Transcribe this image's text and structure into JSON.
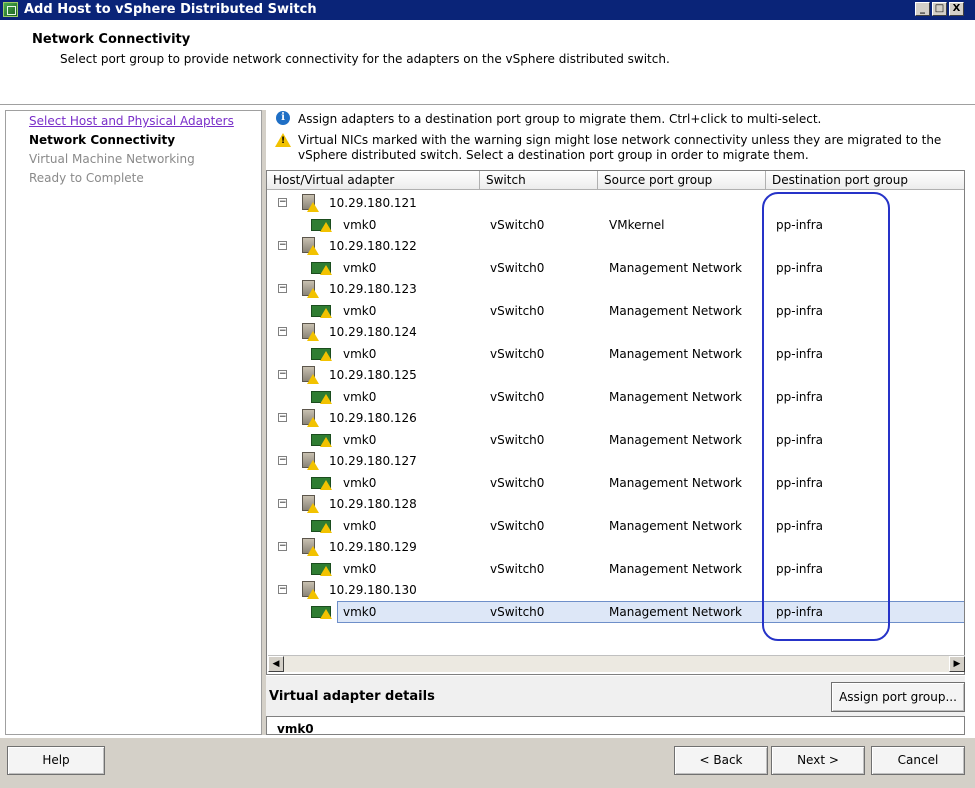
{
  "window": {
    "title": "Add Host to vSphere Distributed Switch",
    "minimize_glyph": "_",
    "maximize_glyph": "□",
    "close_glyph": "X"
  },
  "header": {
    "title": "Network Connectivity",
    "subtitle": "Select port group to provide network connectivity for the adapters on the vSphere distributed switch."
  },
  "steps": [
    {
      "label": "Select Host and Physical Adapters",
      "state": "link"
    },
    {
      "label": "Network Connectivity",
      "state": "current"
    },
    {
      "label": "Virtual Machine Networking",
      "state": "disabled"
    },
    {
      "label": "Ready to Complete",
      "state": "disabled"
    }
  ],
  "info": {
    "icon": "info-icon",
    "text": "Assign adapters to a destination port group to migrate them. Ctrl+click to multi-select.",
    "warning_icon": "warning-icon",
    "warning_text": "Virtual NICs marked with the warning sign might lose network connectivity unless they are migrated to the vSphere distributed switch. Select a destination port group in order to migrate them."
  },
  "table": {
    "columns": [
      "Host/Virtual adapter",
      "Switch",
      "Source port group",
      "Destination port group"
    ],
    "expander_glyph": "−",
    "hosts": [
      {
        "name": "10.29.180.121",
        "adapter": "vmk0",
        "switch": "vSwitch0",
        "source": "VMkernel",
        "dest": "pp-infra"
      },
      {
        "name": "10.29.180.122",
        "adapter": "vmk0",
        "switch": "vSwitch0",
        "source": "Management Network",
        "dest": "pp-infra"
      },
      {
        "name": "10.29.180.123",
        "adapter": "vmk0",
        "switch": "vSwitch0",
        "source": "Management Network",
        "dest": "pp-infra"
      },
      {
        "name": "10.29.180.124",
        "adapter": "vmk0",
        "switch": "vSwitch0",
        "source": "Management Network",
        "dest": "pp-infra"
      },
      {
        "name": "10.29.180.125",
        "adapter": "vmk0",
        "switch": "vSwitch0",
        "source": "Management Network",
        "dest": "pp-infra"
      },
      {
        "name": "10.29.180.126",
        "adapter": "vmk0",
        "switch": "vSwitch0",
        "source": "Management Network",
        "dest": "pp-infra"
      },
      {
        "name": "10.29.180.127",
        "adapter": "vmk0",
        "switch": "vSwitch0",
        "source": "Management Network",
        "dest": "pp-infra"
      },
      {
        "name": "10.29.180.128",
        "adapter": "vmk0",
        "switch": "vSwitch0",
        "source": "Management Network",
        "dest": "pp-infra"
      },
      {
        "name": "10.29.180.129",
        "adapter": "vmk0",
        "switch": "vSwitch0",
        "source": "Management Network",
        "dest": "pp-infra"
      },
      {
        "name": "10.29.180.130",
        "adapter": "vmk0",
        "switch": "vSwitch0",
        "source": "Management Network",
        "dest": "pp-infra",
        "selected": true
      }
    ]
  },
  "scrollbar": {
    "left_glyph": "◀",
    "right_glyph": "▶"
  },
  "details": {
    "title": "Virtual adapter details",
    "assign_button": "Assign port group...",
    "content_partial": "vmk0"
  },
  "footer": {
    "help": "Help",
    "back": "< Back",
    "next": "Next >",
    "cancel": "Cancel"
  },
  "colors": {
    "titlebar": "#0a2478",
    "selection": "#cfdcf2",
    "annotation": "#2633c8",
    "link": "#7a2fc9"
  }
}
